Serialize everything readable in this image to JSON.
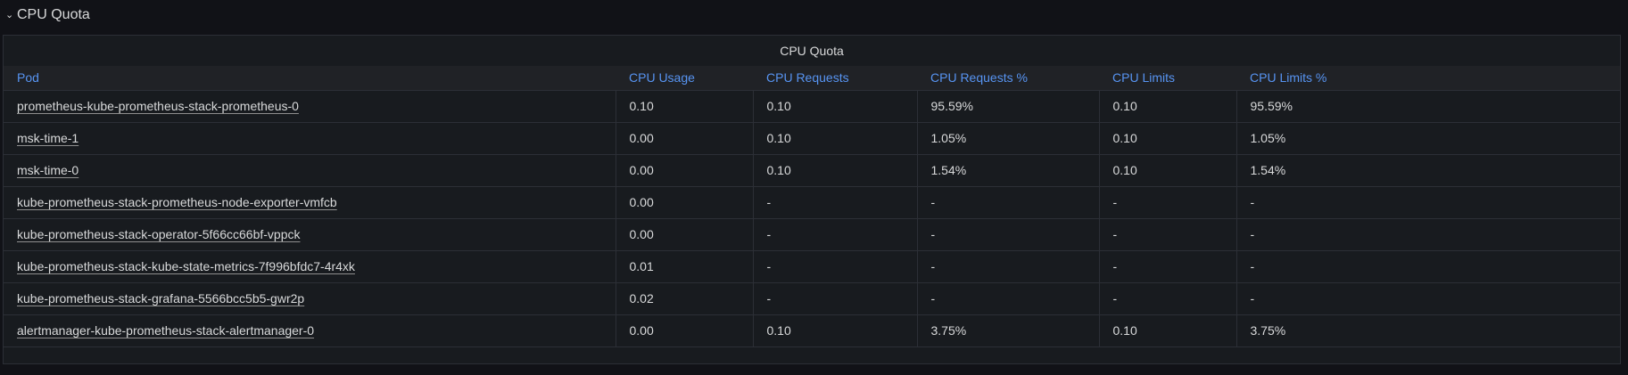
{
  "row": {
    "chevron": "⌄",
    "title": "CPU Quota"
  },
  "panel": {
    "title": "CPU Quota"
  },
  "columns": [
    "Pod",
    "CPU Usage",
    "CPU Requests",
    "CPU Requests %",
    "CPU Limits",
    "CPU Limits %"
  ],
  "rows": [
    [
      "prometheus-kube-prometheus-stack-prometheus-0",
      "0.10",
      "0.10",
      "95.59%",
      "0.10",
      "95.59%"
    ],
    [
      "msk-time-1",
      "0.00",
      "0.10",
      "1.05%",
      "0.10",
      "1.05%"
    ],
    [
      "msk-time-0",
      "0.00",
      "0.10",
      "1.54%",
      "0.10",
      "1.54%"
    ],
    [
      "kube-prometheus-stack-prometheus-node-exporter-vmfcb",
      "0.00",
      "-",
      "-",
      "-",
      "-"
    ],
    [
      "kube-prometheus-stack-operator-5f66cc66bf-vppck",
      "0.00",
      "-",
      "-",
      "-",
      "-"
    ],
    [
      "kube-prometheus-stack-kube-state-metrics-7f996bfdc7-4r4xk",
      "0.01",
      "-",
      "-",
      "-",
      "-"
    ],
    [
      "kube-prometheus-stack-grafana-5566bcc5b5-gwr2p",
      "0.02",
      "-",
      "-",
      "-",
      "-"
    ],
    [
      "alertmanager-kube-prometheus-stack-alertmanager-0",
      "0.00",
      "0.10",
      "3.75%",
      "0.10",
      "3.75%"
    ]
  ]
}
